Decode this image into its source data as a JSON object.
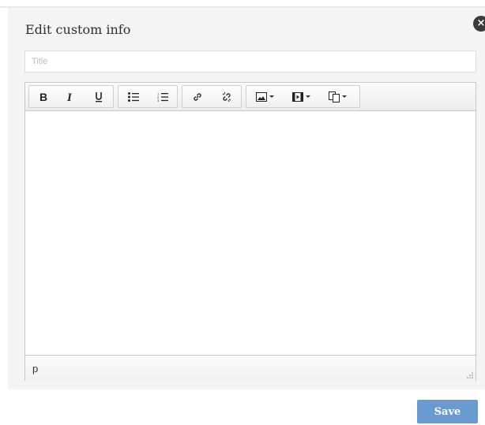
{
  "dialog": {
    "title": "Edit custom info",
    "close_icon_glyph": "×",
    "title_input": {
      "value": "",
      "placeholder": "Title"
    },
    "toolbar": {
      "groups": [
        {
          "items": [
            "bold-icon",
            "italic-icon",
            "underline-icon"
          ]
        },
        {
          "items": [
            "bulleted-list-icon",
            "numbered-list-icon"
          ]
        },
        {
          "items": [
            "link-icon",
            "unlink-icon"
          ]
        },
        {
          "items": [
            "image-icon",
            "media-icon",
            "template-icon"
          ]
        }
      ]
    },
    "statusbar": {
      "path": "p"
    },
    "save_label": "Save"
  },
  "colors": {
    "dialog_bg": "#f4f4f4",
    "save_button_bg": "#6a9bd0",
    "close_icon_bg": "#3b3b3b"
  }
}
